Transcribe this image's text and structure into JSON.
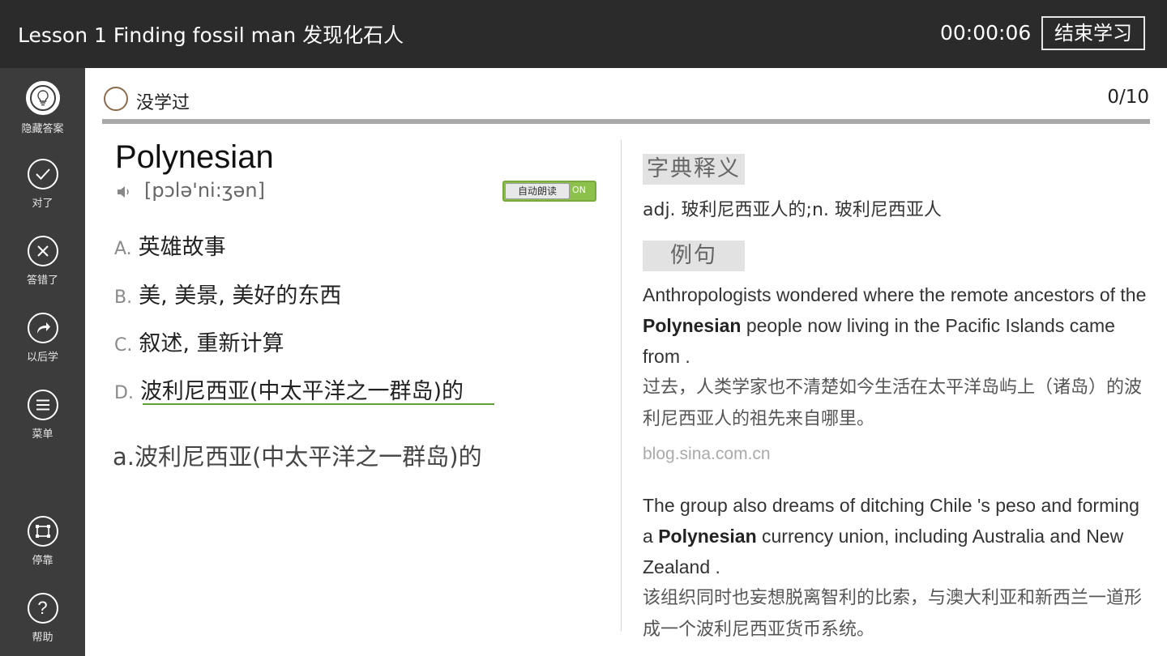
{
  "header": {
    "title": "Lesson 1 Finding fossil man 发现化石人",
    "timer": "00:00:06",
    "end_label": "结束学习"
  },
  "sidebar": {
    "items": [
      {
        "label": "隐藏答案",
        "icon": "lightbulb-icon"
      },
      {
        "label": "对了",
        "icon": "check-icon"
      },
      {
        "label": "答错了",
        "icon": "close-icon"
      },
      {
        "label": "以后学",
        "icon": "forward-arrow-icon"
      },
      {
        "label": "菜单",
        "icon": "menu-icon"
      },
      {
        "label": "停靠",
        "icon": "dock-icon"
      },
      {
        "label": "帮助",
        "icon": "help-icon"
      }
    ]
  },
  "status": {
    "label": "没学过",
    "progress_text": "0/10",
    "progress_fraction": 0
  },
  "word": {
    "text": "Polynesian",
    "phonetic": "[pɔlə'ni:ʒən]",
    "auto_read_label": "自动朗读",
    "auto_read_state": "ON"
  },
  "options": [
    {
      "letter": "A.",
      "text": "英雄故事"
    },
    {
      "letter": "B.",
      "text": "美, 美景, 美好的东西"
    },
    {
      "letter": "C.",
      "text": "叙述, 重新计算"
    },
    {
      "letter": "D.",
      "text": "波利尼西亚(中太平洋之一群岛)的"
    }
  ],
  "answer": "a.波利尼西亚(中太平洋之一群岛)的",
  "dictionary": {
    "heading": "字典释义",
    "definition": "adj. 玻利尼西亚人的;n. 玻利尼西亚人"
  },
  "examples": {
    "heading": "例句",
    "items": [
      {
        "en_before": "Anthropologists wondered where the remote ancestors of the ",
        "en_bold": "Polynesian",
        "en_after": " people now living in the Pacific Islands came from .",
        "cn": "过去，人类学家也不清楚如今生活在太平洋岛屿上（诸岛）的波利尼西亚人的祖先来自哪里。",
        "source": "blog.sina.com.cn"
      },
      {
        "en_before": "The group also dreams of ditching Chile 's peso and forming a ",
        "en_bold": "Polynesian",
        "en_after": " currency union, including Australia and New Zealand .",
        "cn": "该组织同时也妄想脱离智利的比索，与澳大利亚和新西兰一道形成一个波利尼西亚货币系统。"
      }
    ]
  },
  "colors": {
    "topbar": "#2b2b2b",
    "sidebar": "#3c3c3c",
    "accent_green": "#5fa033",
    "status_ring": "#8c6b4a"
  }
}
